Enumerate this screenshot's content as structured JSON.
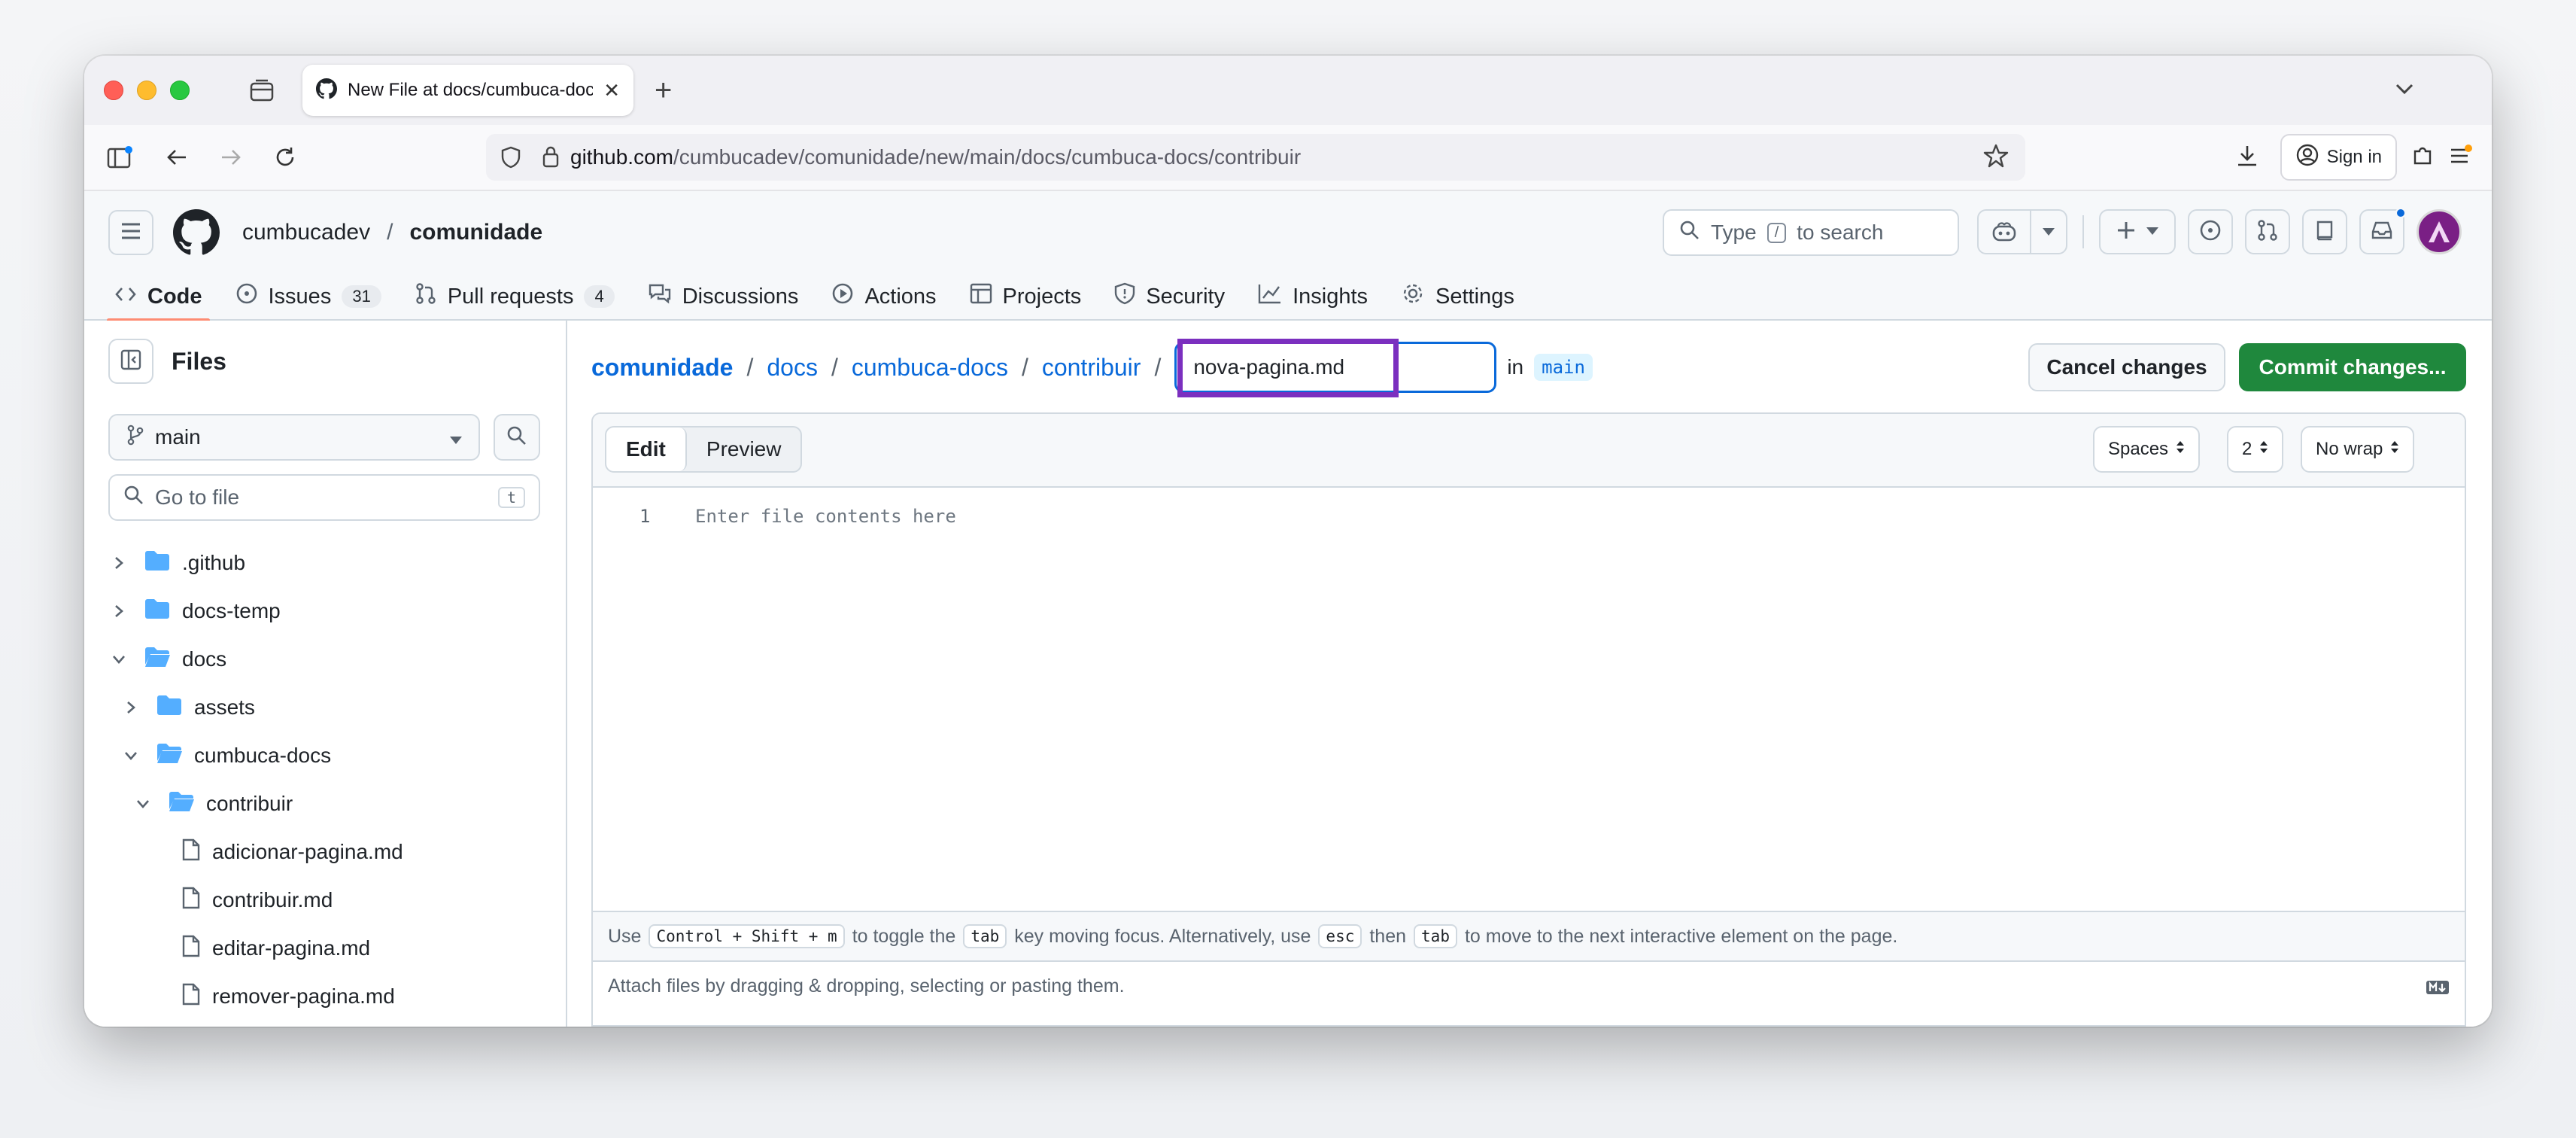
{
  "browser": {
    "tab_title": "New File at docs/cumbuca-docs",
    "url_host": "github.com",
    "url_path": "/cumbucadev/comunidade/new/main/docs/cumbuca-docs/contribuir",
    "signin_label": "Sign in"
  },
  "header": {
    "owner": "cumbucadev",
    "separator": "/",
    "repo": "comunidade",
    "search_prefix": "Type",
    "search_key": "/",
    "search_suffix": "to search"
  },
  "repo_tabs": [
    {
      "label": "Code",
      "icon": "code-icon"
    },
    {
      "label": "Issues",
      "icon": "issue-icon",
      "count": "31"
    },
    {
      "label": "Pull requests",
      "icon": "pull-request-icon",
      "count": "4"
    },
    {
      "label": "Discussions",
      "icon": "discussions-icon"
    },
    {
      "label": "Actions",
      "icon": "play-icon"
    },
    {
      "label": "Projects",
      "icon": "table-icon"
    },
    {
      "label": "Security",
      "icon": "shield-icon"
    },
    {
      "label": "Insights",
      "icon": "graph-icon"
    },
    {
      "label": "Settings",
      "icon": "gear-icon"
    }
  ],
  "sidebar": {
    "title": "Files",
    "branch": "main",
    "goto_placeholder": "Go to file",
    "goto_key": "t",
    "tree": [
      {
        "label": ".github",
        "type": "folder",
        "expanded": false
      },
      {
        "label": "docs-temp",
        "type": "folder",
        "expanded": false
      },
      {
        "label": "docs",
        "type": "folder",
        "expanded": true
      },
      {
        "label": "assets",
        "type": "folder",
        "expanded": false
      },
      {
        "label": "cumbuca-docs",
        "type": "folder",
        "expanded": true
      },
      {
        "label": "contribuir",
        "type": "folder",
        "expanded": true
      },
      {
        "label": "adicionar-pagina.md",
        "type": "file"
      },
      {
        "label": "contribuir.md",
        "type": "file"
      },
      {
        "label": "editar-pagina.md",
        "type": "file"
      },
      {
        "label": "remover-pagina.md",
        "type": "file"
      }
    ]
  },
  "editor": {
    "path": [
      "comunidade",
      "docs",
      "cumbuca-docs",
      "contribuir"
    ],
    "path_sep": "/",
    "filename": "nova-pagina.md",
    "in_label": "in",
    "branch": "main",
    "cancel_label": "Cancel changes",
    "commit_label": "Commit changes...",
    "tab_edit": "Edit",
    "tab_preview": "Preview",
    "indent_mode": "Spaces",
    "indent_size": "2",
    "wrap_mode": "No wrap",
    "line_number": "1",
    "placeholder": "Enter file contents here",
    "help": {
      "t1": "Use",
      "k1": "Control + Shift + m",
      "t2": "to toggle the",
      "k2": "tab",
      "t3": "key moving focus. Alternatively, use",
      "k3": "esc",
      "t4": "then",
      "k4": "tab",
      "t5": "to move to the next interactive element on the page."
    },
    "attach_text": "Attach files by dragging & dropping, selecting or pasting them."
  },
  "colors": {
    "accent": "#0969da",
    "commit_green": "#1f883d",
    "highlight": "#7b2fbf",
    "active_tab_underline": "#fd8c73"
  }
}
